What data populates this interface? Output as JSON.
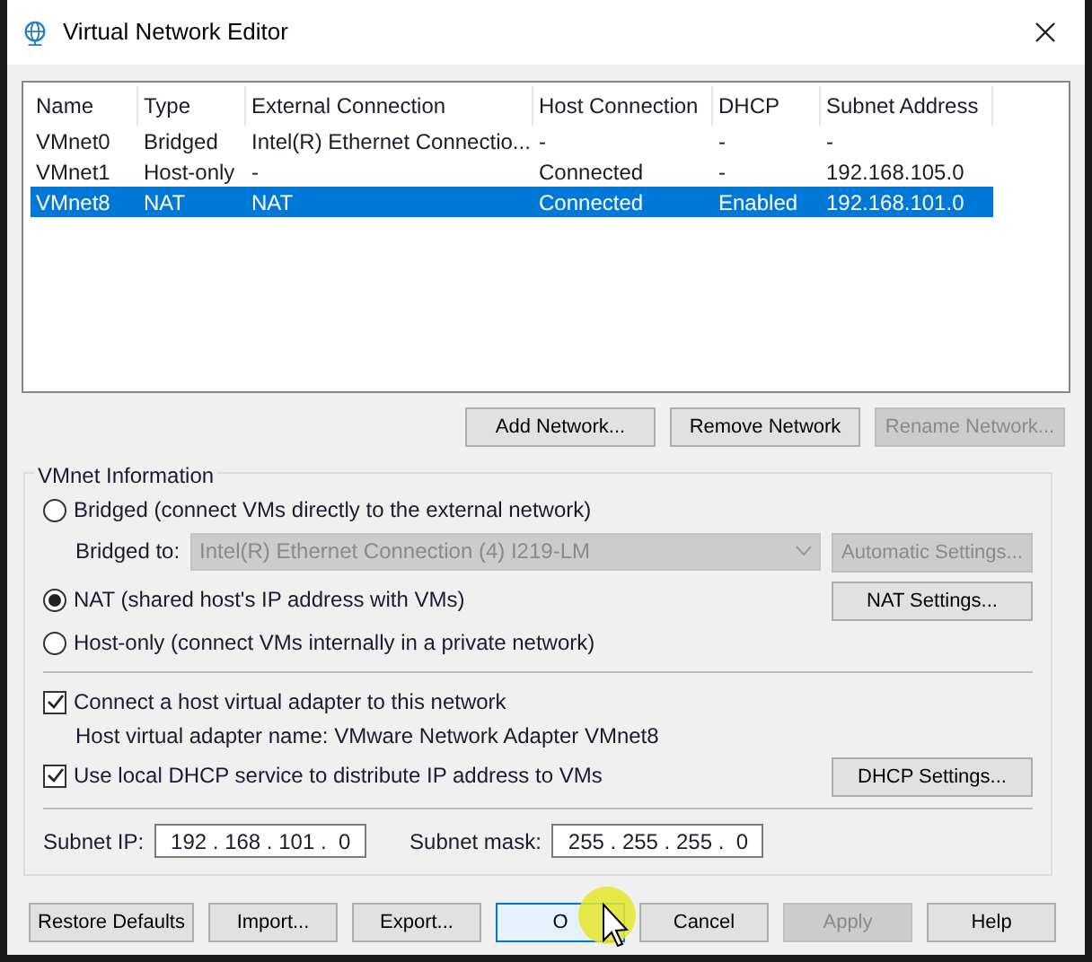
{
  "window": {
    "title": "Virtual Network Editor"
  },
  "table": {
    "columns": [
      "Name",
      "Type",
      "External Connection",
      "Host Connection",
      "DHCP",
      "Subnet Address"
    ],
    "rows": [
      {
        "cells": [
          "VMnet0",
          "Bridged",
          "Intel(R) Ethernet Connectio...",
          "-",
          "-",
          "-"
        ],
        "selected": false
      },
      {
        "cells": [
          "VMnet1",
          "Host-only",
          "-",
          "Connected",
          "-",
          "192.168.105.0"
        ],
        "selected": false
      },
      {
        "cells": [
          "VMnet8",
          "NAT",
          "NAT",
          "Connected",
          "Enabled",
          "192.168.101.0"
        ],
        "selected": true
      }
    ]
  },
  "network_buttons": [
    {
      "label": "Add Network...",
      "disabled": false
    },
    {
      "label": "Remove Network",
      "disabled": false
    },
    {
      "label": "Rename Network...",
      "disabled": true
    }
  ],
  "vmnet_info": {
    "title": "VMnet Information",
    "modes": [
      {
        "label": "Bridged (connect VMs directly to the external network)",
        "selected": false
      },
      {
        "label": "NAT (shared host's IP address with VMs)",
        "selected": true
      },
      {
        "label": "Host-only (connect VMs internally in a private network)",
        "selected": false
      }
    ],
    "bridged_to": {
      "label": "Bridged to:",
      "value": "Intel(R) Ethernet Connection (4) I219-LM",
      "disabled": true
    },
    "automatic_settings": {
      "label": "Automatic Settings...",
      "disabled": true
    },
    "nat_settings": {
      "label": "NAT Settings...",
      "disabled": false
    },
    "connect_adapter": {
      "label": "Connect a host virtual adapter to this network",
      "checked": true
    },
    "adapter_name": "Host virtual adapter name: VMware Network Adapter VMnet8",
    "use_dhcp": {
      "label": "Use local DHCP service to distribute IP address to VMs",
      "checked": true
    },
    "dhcp_settings": {
      "label": "DHCP Settings...",
      "disabled": false
    },
    "subnet_ip": {
      "label": "Subnet IP:",
      "value": "192 . 168 . 101 .  0"
    },
    "subnet_mask": {
      "label": "Subnet mask:",
      "value": "255 . 255 . 255 .  0"
    }
  },
  "footer_buttons": [
    {
      "label": "Restore Defaults",
      "disabled": false,
      "focused": false
    },
    {
      "label": "Import...",
      "disabled": false,
      "focused": false
    },
    {
      "label": "Export...",
      "disabled": false,
      "focused": false
    },
    {
      "label": "O",
      "disabled": false,
      "focused": true
    },
    {
      "label": "Cancel",
      "disabled": false,
      "focused": false
    },
    {
      "label": "Apply",
      "disabled": true,
      "focused": false
    },
    {
      "label": "Help",
      "disabled": false,
      "focused": false
    }
  ]
}
